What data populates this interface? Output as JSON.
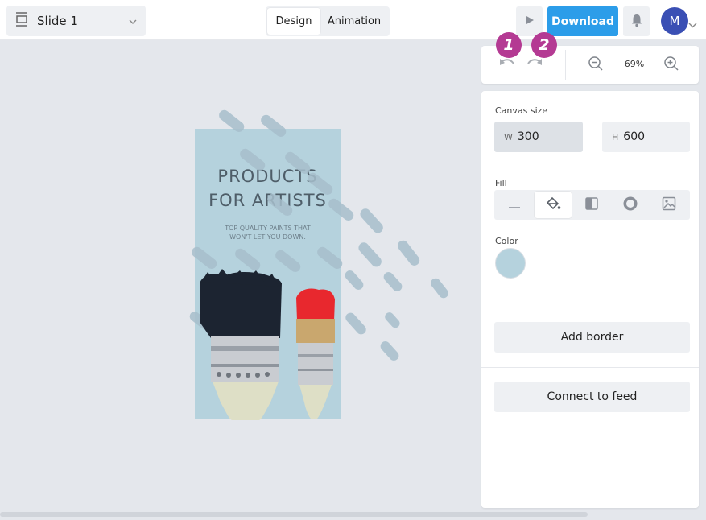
{
  "header": {
    "slide_select": {
      "label": "Slide 1"
    },
    "tabs": [
      {
        "label": "Design",
        "active": true
      },
      {
        "label": "Animation",
        "active": false
      }
    ],
    "download_label": "Download",
    "avatar_initial": "M",
    "accent_color": "#2c9de9",
    "avatar_color": "#3a4fb4"
  },
  "history": {
    "badges": [
      "1",
      "2"
    ],
    "badge_color": "#b43a93",
    "zoom_level": "69%"
  },
  "slide": {
    "background": "#b5d2dd",
    "title_line1": "PRODUCTS",
    "title_line2": "FOR ARTISTS",
    "subtitle_line1": "TOP QUALITY PAINTS THAT",
    "subtitle_line2": "WON'T LET YOU DOWN."
  },
  "panel": {
    "canvas_size_label": "Canvas size",
    "width_prefix": "W",
    "width_value": "300",
    "height_prefix": "H",
    "height_value": "600",
    "fill_label": "Fill",
    "fill_options": [
      "none-icon",
      "paint-bucket-icon",
      "linear-gradient-icon",
      "radial-gradient-icon",
      "image-icon"
    ],
    "fill_active": "paint-bucket-icon",
    "color_label": "Color",
    "color_value": "#b5d2dd",
    "add_border_label": "Add border",
    "connect_feed_label": "Connect to feed"
  }
}
